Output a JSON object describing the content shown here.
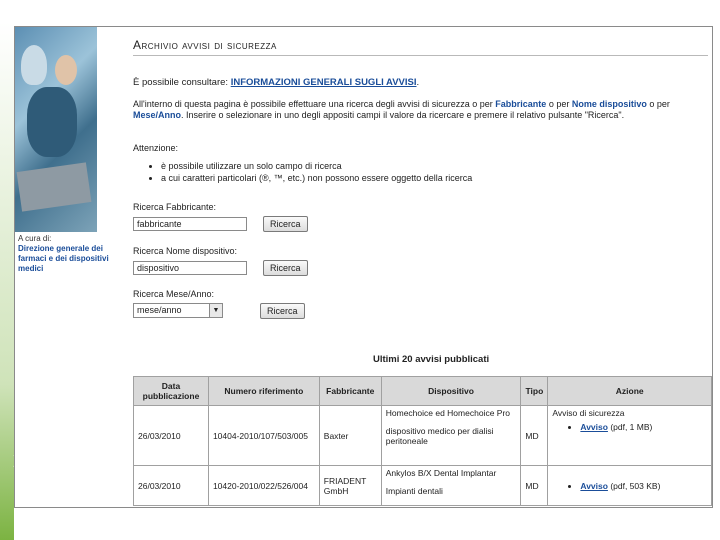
{
  "page": {
    "title": "Archivio avvisi di sicurezza",
    "intro_text": "È possibile consultare:",
    "intro_link": "INFORMAZIONI GENERALI SUGLI AVVISI",
    "intro_end": ".",
    "search_text_1": "All'interno di questa pagina è possibile effettuare una ricerca degli avvisi di sicurezza o per",
    "search_bold_1": "Fabbricante",
    "search_text_2": "o per",
    "search_bold_2": "Nome dispositivo",
    "search_text_3": "o per",
    "search_bold_3": "Mese/Anno",
    "search_text_4": ". Inserire o selezionare in uno degli appositi campi il valore da ricercare e premere il relativo pulsante \"Ricerca\".",
    "attention_label": "Attenzione:",
    "attention_items": [
      "è possibile utilizzare un solo campo di ricerca",
      "a cui caratteri particolari (®, ™, etc.) non possono essere oggetto della ricerca"
    ],
    "curator": {
      "prefix": "A cura di:",
      "department": "Direzione generale dei farmaci e dei dispositivi medici"
    }
  },
  "search": {
    "manufacturer_label": "Ricerca Fabbricante:",
    "manufacturer_value": "fabbricante",
    "device_label": "Ricerca Nome dispositivo:",
    "device_value": "dispositivo",
    "month_label": "Ricerca Mese/Anno:",
    "month_value": "mese/anno",
    "button_label": "Ricerca"
  },
  "table": {
    "caption": "Ultimi 20 avvisi pubblicati",
    "headers": [
      "Data pubblicazione",
      "Numero riferimento",
      "Fabbricante",
      "Dispositivo",
      "Tipo",
      "Azione"
    ],
    "rows": [
      {
        "date": "26/03/2010",
        "ref": "10404-2010/107/503/005",
        "manufacturer": "Baxter",
        "device_name": "Homechoice ed Homechoice Pro",
        "device_desc": "dispositivo medico per dialisi peritoneale",
        "type": "MD",
        "action_title": "Avviso di sicurezza",
        "action_link": "Avviso",
        "action_info": "(pdf, 1 MB)"
      },
      {
        "date": "26/03/2010",
        "ref": "10420-2010/022/526/004",
        "manufacturer": "FRIADENT GmbH",
        "device_name": "Ankylos B/X Dental Implantar",
        "device_desc": "Impianti dentali",
        "type": "MD",
        "action_title": "",
        "action_link": "Avviso",
        "action_info": "(pdf, 503 KB)"
      }
    ]
  },
  "colors": {
    "link": "#1a4d99",
    "header_bg": "#d9d9d9",
    "slide_accent": "#7cb342"
  }
}
